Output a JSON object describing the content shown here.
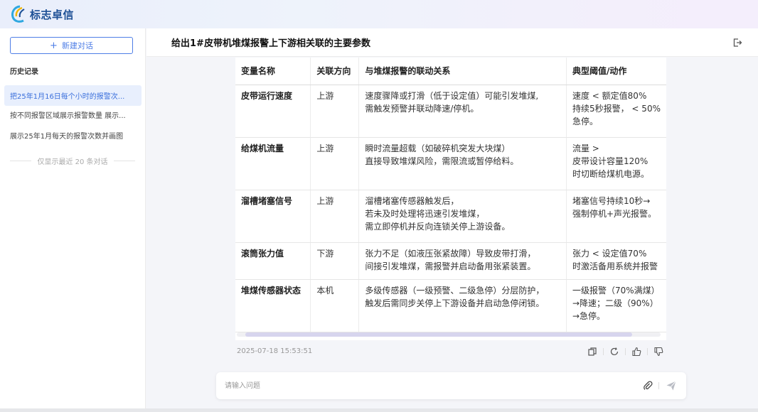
{
  "brand": {
    "logo_text": "标志卓信",
    "colors": {
      "primary": "#4e7ee6",
      "logo_blue": "#1c4f95",
      "logo_yellow": "#f2b705",
      "logo_cyan": "#2fa8e0"
    }
  },
  "sidebar": {
    "new_chat_label": "新建对话",
    "history_title": "历史记录",
    "items": [
      {
        "label": "把25年1月16日每个小时的报警次...",
        "active": true
      },
      {
        "label": "按不同报警区域展示报警数量 展示...",
        "active": false
      },
      {
        "label": "展示25年1月每天的报警次数并画图",
        "active": false
      }
    ],
    "note": "仅显示最近 20 条对话"
  },
  "header": {
    "title": "给出1#皮带机堆煤报警上下游相关联的主要参数",
    "logout_icon": "logout-icon"
  },
  "table": {
    "columns": [
      "变量名称",
      "关联方向",
      "与堆煤报警的联动关系",
      "典型阈值/动作"
    ],
    "rows": [
      {
        "name": "皮带运行速度",
        "direction": "上游",
        "relation": [
          "速度骤降或打滑（低于设定值）可能引发堆煤,",
          "需触发预警并联动降速/停机。"
        ],
        "threshold": [
          "速度 < 额定值80%",
          "持续5秒报警，  < 50%",
          "急停。"
        ]
      },
      {
        "name": "给煤机流量",
        "direction": "上游",
        "relation": [
          "瞬时流量超载（如破碎机突发大块煤）",
          "直接导致堆煤风险，需限流或暂停给料。"
        ],
        "threshold": [
          "流量 >",
          "皮带设计容量120%",
          "时切断给煤机电源。"
        ]
      },
      {
        "name": "溜槽堵塞信号",
        "direction": "上游",
        "relation": [
          "溜槽堵塞传感器触发后，",
          "若未及时处理将迅速引发堆煤，",
          "需立即停机并反向连锁关停上游设备。"
        ],
        "threshold": [
          "堵塞信号持续10秒→",
          "强制停机+声光报警。"
        ]
      },
      {
        "name": "滚筒张力值",
        "direction": "下游",
        "relation": [
          "张力不足（如液压张紧故障）导致皮带打滑，",
          "间接引发堆煤，需报警并启动备用张紧装置。"
        ],
        "threshold": [
          "张力 < 设定值70%",
          "时激活备用系统并报警"
        ]
      },
      {
        "name": "堆煤传感器状态",
        "direction": "本机",
        "relation": [
          "多级传感器（一级预警、二级急停）分层防护，",
          "触发后需同步关停上下游设备并启动急停闭锁。"
        ],
        "threshold": [
          "一级报警（70%满煤）",
          "→降速；二级（90%）",
          "→急停。"
        ]
      }
    ],
    "scroll_fraction_visible": 0.92
  },
  "message": {
    "timestamp": "2025-07-18 15:53:51",
    "actions": [
      "copy-icon",
      "refresh-icon",
      "thumbs-up-icon",
      "thumbs-down-icon"
    ]
  },
  "composer": {
    "placeholder": "请输入问题",
    "attach_icon": "paperclip-icon",
    "send_icon": "send-icon"
  }
}
